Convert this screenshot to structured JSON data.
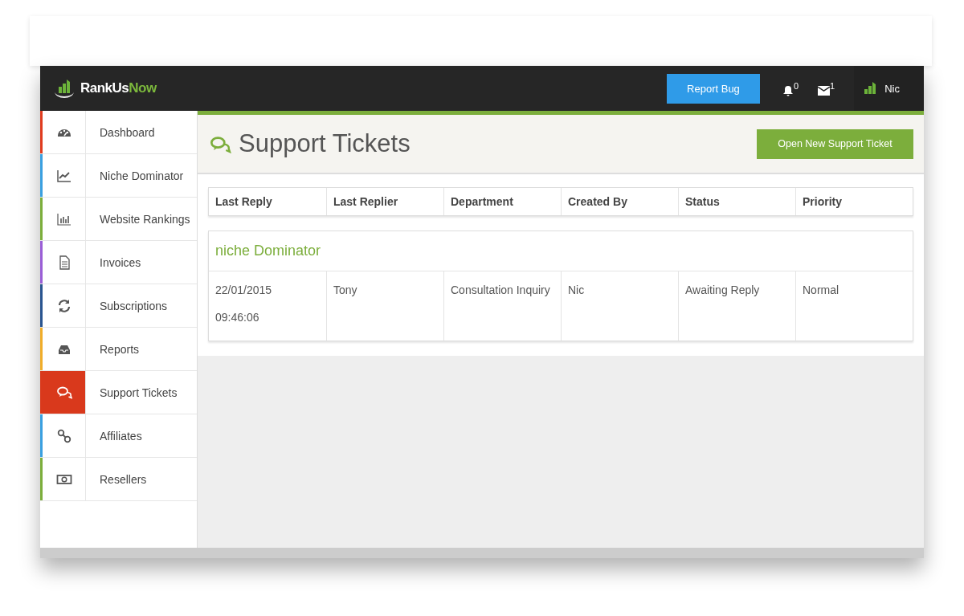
{
  "header": {
    "logo": {
      "first": "RankUs",
      "second": "Now"
    },
    "report_button": "Report Bug",
    "notifications": "0",
    "messages": "1",
    "user": "Nic"
  },
  "sidebar": {
    "items": [
      {
        "label": "Dashboard",
        "color": "#e03c1f",
        "selected": false
      },
      {
        "label": "Niche Dominator",
        "color": "#3aa0e0",
        "selected": false
      },
      {
        "label": "Website Rankings",
        "color": "#7cae3c",
        "selected": false
      },
      {
        "label": "Invoices",
        "color": "#9a5ed6",
        "selected": false
      },
      {
        "label": "Subscriptions",
        "color": "#2a5590",
        "selected": false
      },
      {
        "label": "Reports",
        "color": "#f0ad2a",
        "selected": false
      },
      {
        "label": "Support Tickets",
        "color": "#d9391c",
        "selected": true
      },
      {
        "label": "Affiliates",
        "color": "#3aa0e0",
        "selected": false
      },
      {
        "label": "Resellers",
        "color": "#7cae3c",
        "selected": false
      }
    ]
  },
  "page": {
    "title": "Support Tickets",
    "new_button": "Open New Support Ticket"
  },
  "table": {
    "columns": [
      "Last Reply",
      "Last Replier",
      "Department",
      "Created By",
      "Status",
      "Priority"
    ],
    "groups": [
      {
        "title": "niche Dominator",
        "rows": [
          {
            "cells": [
              [
                "22/01/2015",
                "09:46:06"
              ],
              [
                "Tony"
              ],
              [
                "Consultation Inquiry"
              ],
              [
                "Nic"
              ],
              [
                "Awaiting Reply"
              ],
              [
                "Normal"
              ]
            ]
          }
        ]
      }
    ]
  }
}
